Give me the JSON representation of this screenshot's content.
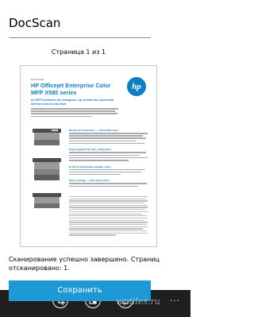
{
  "app": {
    "title": "DocScan"
  },
  "page_counter": "Страница 1 из 1",
  "document_preview": {
    "kicker": "Data sheet",
    "title": "HP Officejet Enterprise Color MFP X585 series",
    "subtitle": "An MFP behind for the enterprise—up to twice the speed and half the cost of color laser",
    "logo_text": "hp",
    "section_headings": [
      "Ready for business — out-of-the-box",
      "Help support for the enterprise",
      "Print professional-quality color",
      "Save energy — and save more"
    ]
  },
  "status": "Сканирование успешно завершено. Страниц отсканировано: 1.",
  "save_button": {
    "label": "Сохранить"
  },
  "app_bar": {
    "buttons": [
      {
        "name": "crop-icon"
      },
      {
        "name": "filter-icon"
      },
      {
        "name": "rotate-icon"
      }
    ],
    "more": "..."
  },
  "watermark": "wptiles.ru",
  "colors": {
    "accent": "#1f98d6",
    "doc_blue": "#0b7fc1",
    "app_bar": "#1f1f1f"
  }
}
